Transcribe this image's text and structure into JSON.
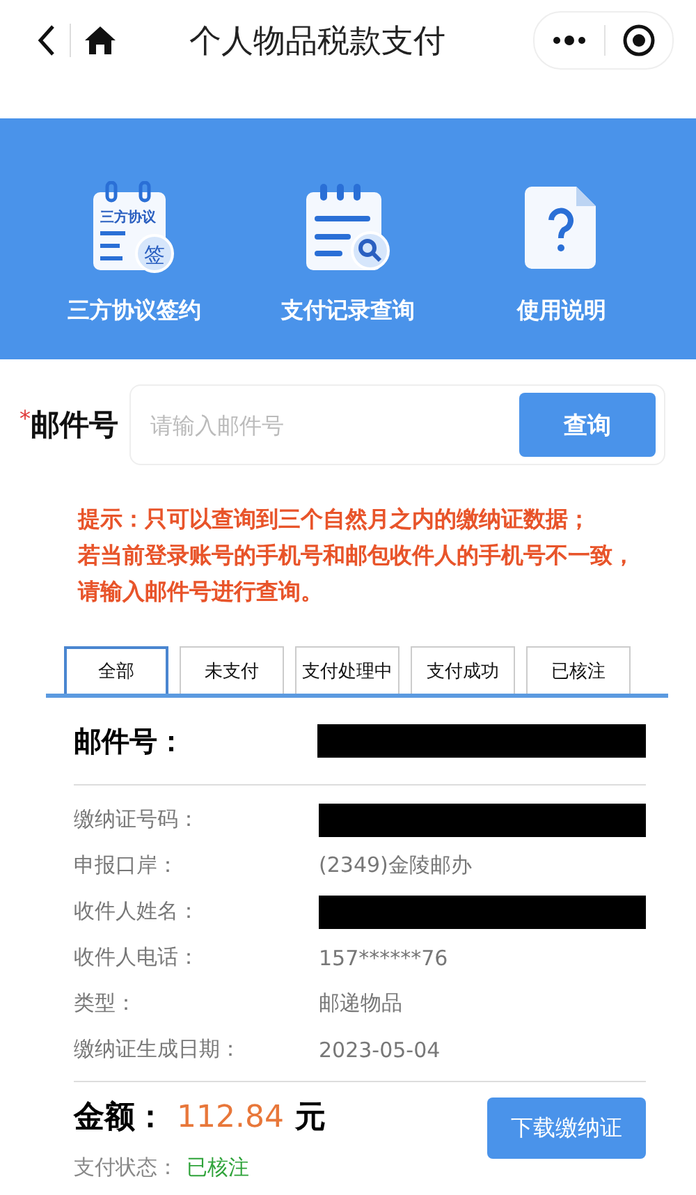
{
  "nav": {
    "title": "个人物品税款支付"
  },
  "shortcuts": [
    {
      "kind": "agreement",
      "label": "三方协议签约",
      "icon_text": "三方协议",
      "badge": "签"
    },
    {
      "kind": "records",
      "label": "支付记录查询"
    },
    {
      "kind": "help",
      "label": "使用说明"
    }
  ],
  "query": {
    "required_mark": "*",
    "label": "邮件号",
    "placeholder": "请输入邮件号",
    "button": "查询"
  },
  "hint": [
    "提示：只可以查询到三个自然月之内的缴纳证数据；",
    "若当前登录账号的手机号和邮包收件人的手机号不一致，请输入邮件号进行查询。"
  ],
  "tabs": [
    {
      "label": "全部",
      "selected": true
    },
    {
      "label": "未支付",
      "selected": false
    },
    {
      "label": "支付处理中",
      "selected": false
    },
    {
      "label": "支付成功",
      "selected": false
    },
    {
      "label": "已核注",
      "selected": false
    }
  ],
  "record": {
    "header": {
      "label": "邮件号：",
      "redacted": true
    },
    "fields": [
      {
        "label": "缴纳证号码：",
        "redacted": true
      },
      {
        "label": "申报口岸：",
        "value": "(2349)金陵邮办"
      },
      {
        "label": "收件人姓名：",
        "redacted": true
      },
      {
        "label": "收件人电话：",
        "value": "157******76"
      },
      {
        "label": "类型：",
        "value": "邮递物品"
      },
      {
        "label": "缴纳证生成日期：",
        "value": "2023-05-04"
      }
    ],
    "amount_label": "金额：",
    "amount": "112.84",
    "currency": "元",
    "status_label": "支付状态：",
    "status": "已核注",
    "button": "下载缴纳证"
  }
}
